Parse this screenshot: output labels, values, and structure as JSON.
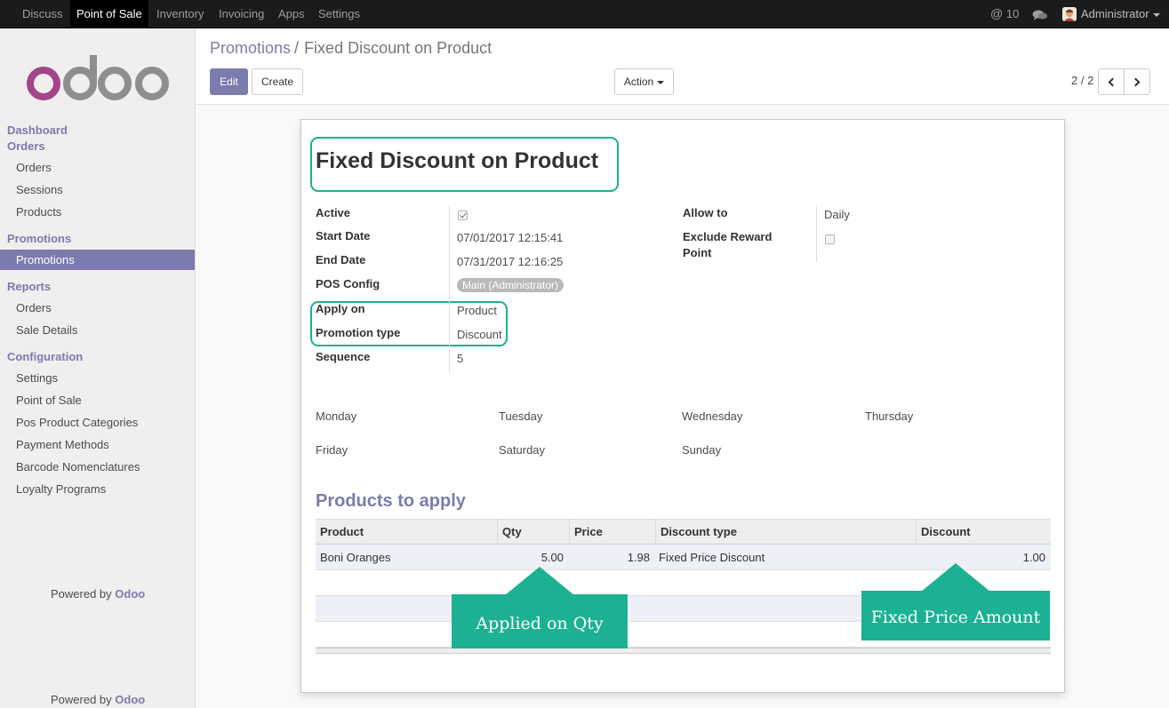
{
  "topbar": {
    "menu": [
      "Discuss",
      "Point of Sale",
      "Inventory",
      "Invoicing",
      "Apps",
      "Settings"
    ],
    "active_menu": "Point of Sale",
    "mentions": "10",
    "user": "Administrator"
  },
  "sidebar": {
    "logo": "odoo",
    "sections": [
      {
        "label": "Dashboard"
      },
      {
        "label": "Orders",
        "items": [
          "Orders",
          "Sessions",
          "Products"
        ]
      },
      {
        "label": "Promotions",
        "items": [
          "Promotions"
        ]
      },
      {
        "label": "Reports",
        "items": [
          "Orders",
          "Sale Details"
        ]
      },
      {
        "label": "Configuration",
        "items": [
          "Settings",
          "Point of Sale",
          "Pos Product Categories",
          "Payment Methods",
          "Barcode Nomenclatures",
          "Loyalty Programs"
        ]
      }
    ],
    "active_item": "Promotions",
    "powered_prefix": "Powered by",
    "powered_brand": "Odoo"
  },
  "control": {
    "breadcrumb_parent": "Promotions",
    "breadcrumb_sep": "/",
    "breadcrumb_current": "Fixed Discount on Product",
    "edit_label": "Edit",
    "create_label": "Create",
    "action_label": "Action",
    "pager": "2 / 2"
  },
  "form": {
    "title": "Fixed Discount on Product",
    "active_label": "Active",
    "active_value": true,
    "start_date_label": "Start Date",
    "start_date": "07/01/2017 12:15:41",
    "end_date_label": "End Date",
    "end_date": "07/31/2017 12:16:25",
    "pos_config_label": "POS Config",
    "pos_config": "Main (Administrator)",
    "apply_on_label": "Apply on",
    "apply_on": "Product",
    "promotion_type_label": "Promotion type",
    "promotion_type": "Discount",
    "sequence_label": "Sequence",
    "sequence": "5",
    "allow_to_label": "Allow to",
    "allow_to": "Daily",
    "exclude_reward_label": "Exclude Reward Point",
    "exclude_reward": false,
    "days": [
      "Monday",
      "Tuesday",
      "Wednesday",
      "Thursday",
      "Friday",
      "Saturday",
      "Sunday"
    ]
  },
  "products": {
    "section_title": "Products to apply",
    "columns": [
      "Product",
      "Qty",
      "Price",
      "Discount type",
      "Discount"
    ],
    "rows": [
      {
        "product": "Boni Oranges",
        "qty": "5.00",
        "price": "1.98",
        "discount_type": "Fixed Price Discount",
        "discount": "1.00"
      }
    ]
  },
  "callouts": {
    "qty": "Applied on Qty",
    "amount": "Fixed Price Amount",
    "color": "#1cb192"
  },
  "colors": {
    "brand": "#7c7bad",
    "topbar": "#1b1b1b",
    "highlight": "#1cb192"
  }
}
